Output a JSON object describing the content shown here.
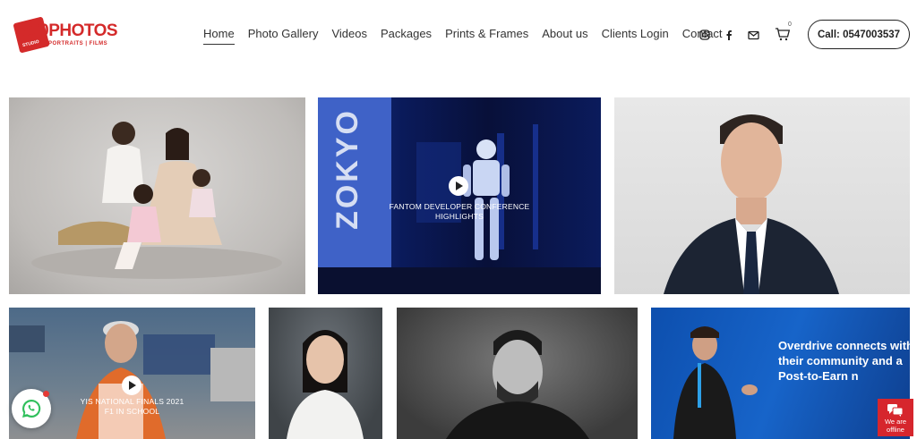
{
  "brand": {
    "logo_main": "800PHOTOS",
    "logo_studio": "STUDIO",
    "logo_sub": "PORTRAITS | FILMS",
    "color": "#d42a2a"
  },
  "nav": {
    "items": [
      {
        "label": "Home",
        "active": true
      },
      {
        "label": "Photo Gallery"
      },
      {
        "label": "Videos"
      },
      {
        "label": "Packages"
      },
      {
        "label": "Prints & Frames"
      },
      {
        "label": "About us"
      },
      {
        "label": "Clients Login"
      },
      {
        "label": "Contact"
      }
    ]
  },
  "socials": [
    "instagram-icon",
    "facebook-icon",
    "mail-icon"
  ],
  "cart": {
    "count": "0"
  },
  "call_button": "Call: 0547003537",
  "gallery": {
    "video_1_caption": "FANTOM DEVELOPER CONFERENCE HIGHLIGHTS",
    "video_1_sign": "ZOKYO",
    "video_2_caption": "YIS NATIONAL FINALS 2021 F1 IN SCHOOL",
    "slide_text": "Overdrive connects with their community and a Post-to-Earn n"
  },
  "chat": {
    "status": "We are offline"
  }
}
